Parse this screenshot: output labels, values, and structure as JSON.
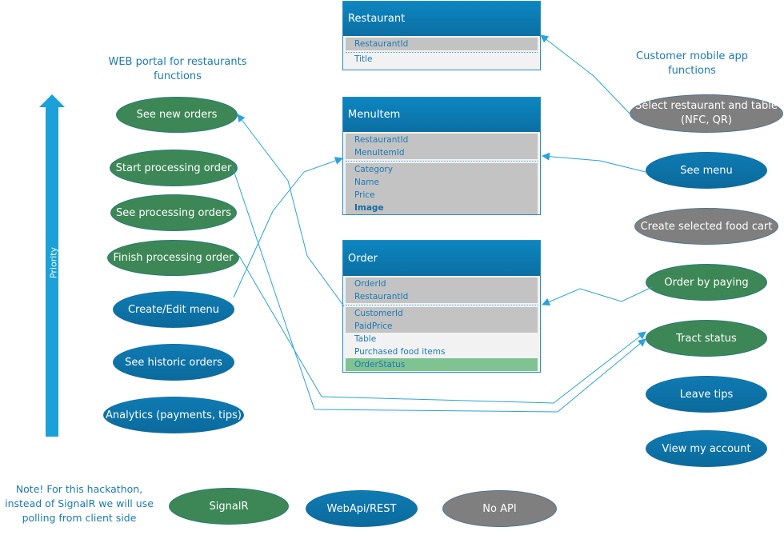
{
  "captions": {
    "web_portal": "WEB portal for restaurants functions",
    "customer_app": "Customer mobile app functions",
    "note": "Note! For this hackathon, instead of SignalR we will use polling from client side"
  },
  "priority": {
    "label": "Priority",
    "direction": "up"
  },
  "colors": {
    "signalr": "#3d8756",
    "webapi": "#0e74a8",
    "no_api": "#7f7f7f",
    "connector": "#29a3db",
    "status_field": "#7fc392"
  },
  "web_functions": [
    {
      "label": "See new orders",
      "api": "SignalR"
    },
    {
      "label": "Start processing order",
      "api": "SignalR"
    },
    {
      "label": "See processing orders",
      "api": "SignalR"
    },
    {
      "label": "Finish processing order",
      "api": "SignalR"
    },
    {
      "label": "Create/Edit menu",
      "api": "WebApi/REST"
    },
    {
      "label": "See historic orders",
      "api": "WebApi/REST"
    },
    {
      "label": "Analytics (payments, tips)",
      "api": "WebApi/REST"
    }
  ],
  "customer_functions": [
    {
      "label": "Select restaurant and table (NFC, QR)",
      "api": "No API"
    },
    {
      "label": "See menu",
      "api": "WebApi/REST"
    },
    {
      "label": "Create selected food cart",
      "api": "No API"
    },
    {
      "label": "Order by paying",
      "api": "SignalR"
    },
    {
      "label": "Tract status",
      "api": "SignalR"
    },
    {
      "label": "Leave tips",
      "api": "WebApi/REST"
    },
    {
      "label": "View my account",
      "api": "WebApi/REST"
    }
  ],
  "entities": {
    "restaurant": {
      "title": "Restaurant",
      "keys": [
        "RestaurantId"
      ],
      "fields": [
        "Title"
      ]
    },
    "menuitem": {
      "title": "MenuItem",
      "keys": [
        "RestaurantId",
        "MenuItemId"
      ],
      "fields": [
        "Category",
        "Name",
        "Price",
        "Image"
      ]
    },
    "order": {
      "title": "Order",
      "keys": [
        "OrderId",
        "RestaurantId"
      ],
      "key_fields": [
        "CustomerId",
        "PaidPrice"
      ],
      "fields": [
        "Table",
        "Purchased food items"
      ],
      "status_field": "OrderStatus"
    }
  },
  "legend": [
    {
      "label": "SignalR"
    },
    {
      "label": "WebApi/REST"
    },
    {
      "label": "No API"
    }
  ]
}
